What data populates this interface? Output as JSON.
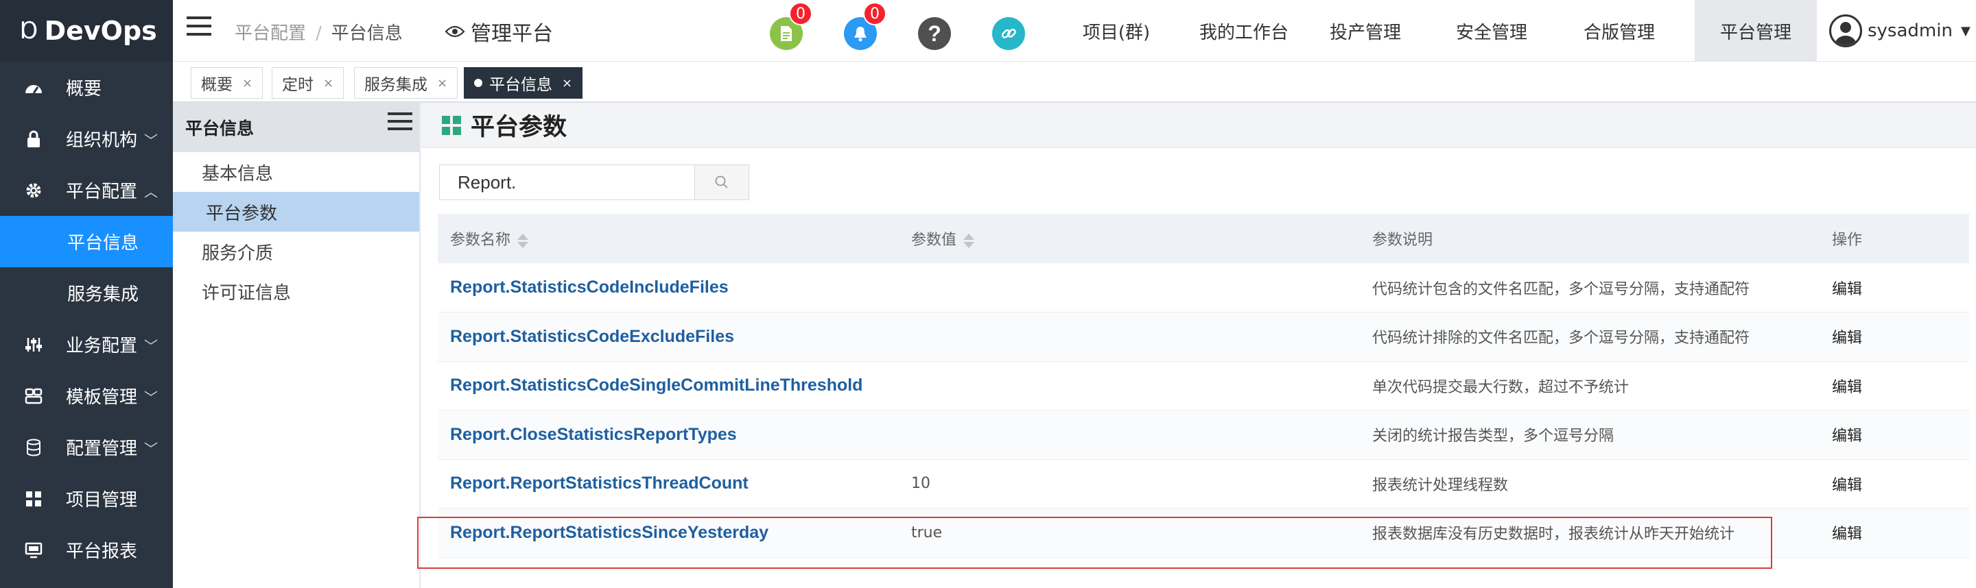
{
  "app": {
    "logo_text": "DevOps"
  },
  "sidebar": {
    "items": [
      {
        "label": "概要",
        "icon": "dashboard-icon"
      },
      {
        "label": "组织机构",
        "icon": "lock-icon"
      },
      {
        "label": "平台配置",
        "icon": "gear-icon",
        "expanded": true,
        "children": [
          {
            "label": "平台信息",
            "active": true
          },
          {
            "label": "服务集成"
          }
        ]
      },
      {
        "label": "业务配置",
        "icon": "sliders-icon"
      },
      {
        "label": "模板管理",
        "icon": "template-icon"
      },
      {
        "label": "配置管理",
        "icon": "database-icon"
      },
      {
        "label": "项目管理",
        "icon": "grid-icon"
      },
      {
        "label": "平台报表",
        "icon": "monitor-icon"
      }
    ]
  },
  "header": {
    "breadcrumb": [
      "平台配置",
      "平台信息"
    ],
    "mgmt_label": "管理平台",
    "doc_badge": "0",
    "bell_badge": "0",
    "nav": [
      "项目(群)",
      "我的工作台",
      "投产管理",
      "安全管理",
      "合版管理",
      "平台管理"
    ],
    "active_nav": "平台管理",
    "user": "sysadmin",
    "colors": {
      "doc": "#8bc34a",
      "bell": "#2b9af3",
      "help": "#505050",
      "link": "#26b7c9"
    }
  },
  "tabs": [
    {
      "label": "概要"
    },
    {
      "label": "定时"
    },
    {
      "label": "服务集成"
    },
    {
      "label": "平台信息",
      "active": true
    }
  ],
  "submenu": {
    "title": "平台信息",
    "items": [
      "基本信息",
      "平台参数",
      "服务介质",
      "许可证信息"
    ],
    "active": "平台参数"
  },
  "main": {
    "title": "平台参数",
    "search_value": "Report.",
    "columns": [
      "参数名称",
      "参数值",
      "参数说明",
      "操作"
    ],
    "rows": [
      {
        "name": "Report.StatisticsCodeIncludeFiles",
        "value": "",
        "desc": "代码统计包含的文件名匹配，多个逗号分隔，支持通配符",
        "op": "编辑"
      },
      {
        "name": "Report.StatisticsCodeExcludeFiles",
        "value": "",
        "desc": "代码统计排除的文件名匹配，多个逗号分隔，支持通配符",
        "op": "编辑"
      },
      {
        "name": "Report.StatisticsCodeSingleCommitLineThreshold",
        "value": "",
        "desc": "单次代码提交最大行数，超过不予统计",
        "op": "编辑"
      },
      {
        "name": "Report.CloseStatisticsReportTypes",
        "value": "",
        "desc": "关闭的统计报告类型，多个逗号分隔",
        "op": "编辑"
      },
      {
        "name": "Report.ReportStatisticsThreadCount",
        "value": "10",
        "desc": "报表统计处理线程数",
        "op": "编辑"
      },
      {
        "name": "Report.ReportStatisticsSinceYesterday",
        "value": "true",
        "desc": "报表数据库没有历史数据时，报表统计从昨天开始统计",
        "op": "编辑"
      }
    ]
  }
}
